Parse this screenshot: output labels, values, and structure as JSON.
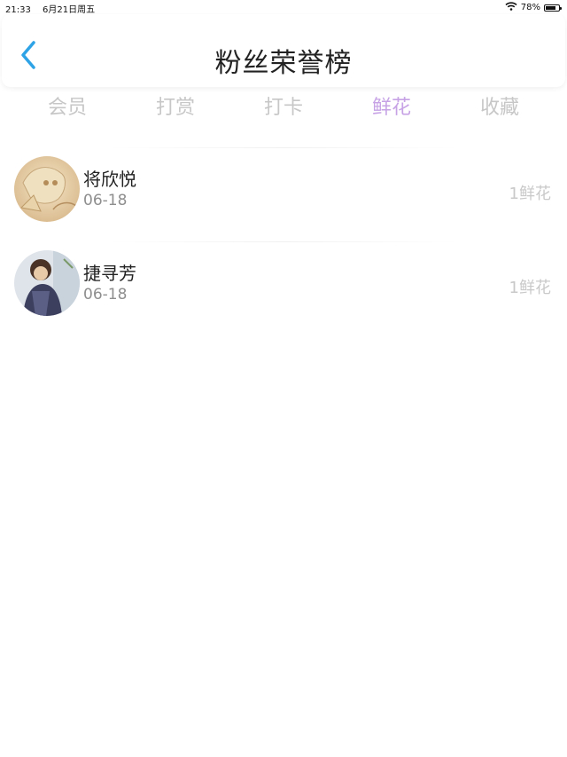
{
  "status_bar": {
    "time": "21:33",
    "date": "6月21日周五",
    "battery_percent": "78%",
    "battery_level": 0.78
  },
  "header": {
    "title": "粉丝荣誉榜",
    "back_icon": "chevron-left-icon",
    "accent_color": "#2ea3e6"
  },
  "tabs": [
    {
      "label": "会员",
      "active": false
    },
    {
      "label": "打赏",
      "active": false
    },
    {
      "label": "打卡",
      "active": false
    },
    {
      "label": "鲜花",
      "active": true
    },
    {
      "label": "收藏",
      "active": false
    }
  ],
  "colors": {
    "tab_inactive": "#c7c7c7",
    "tab_active": "#c7a3e6",
    "count_text": "#c9c9c9"
  },
  "list": [
    {
      "name": "将欣悦",
      "date": "06-18",
      "count": "1鲜花",
      "avatar": "anime-sketch-avatar"
    },
    {
      "name": "捷寻芳",
      "date": "06-18",
      "count": "1鲜花",
      "avatar": "anime-character-avatar"
    }
  ]
}
